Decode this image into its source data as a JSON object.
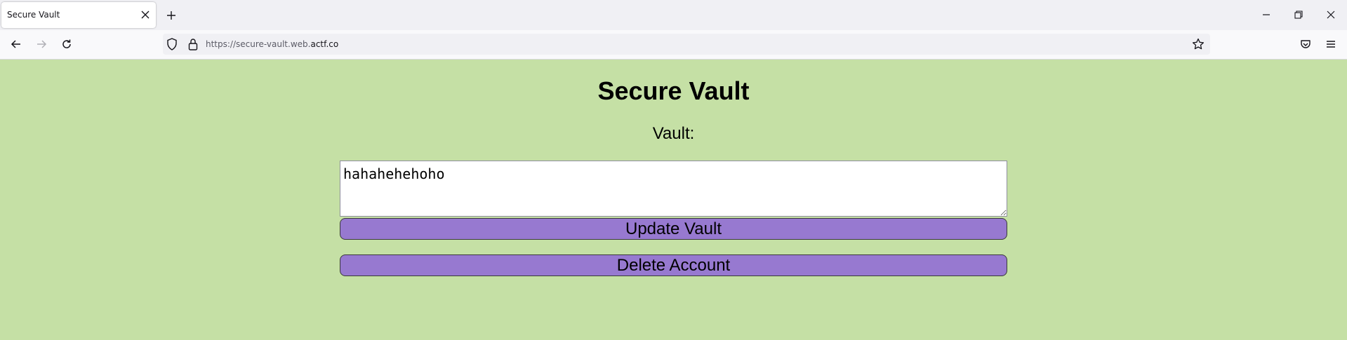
{
  "browser": {
    "tab_title": "Secure Vault",
    "url_prefix": "https://secure-vault.web.",
    "url_domain": "actf.co"
  },
  "page": {
    "title": "Secure Vault",
    "vault_label": "Vault:",
    "vault_value": "hahahehehoho",
    "update_button": "Update Vault",
    "delete_button": "Delete Account"
  },
  "colors": {
    "page_background": "#c5e0a5",
    "button_background": "#9779d0"
  },
  "icons": {
    "tab_close": "close-icon",
    "new_tab": "plus-icon",
    "back": "arrow-left-icon",
    "forward": "arrow-right-icon",
    "reload": "reload-icon",
    "tracking_protection": "shield-icon",
    "connection": "lock-icon",
    "bookmark": "star-icon",
    "pocket": "pocket-icon",
    "menu": "hamburger-menu-icon",
    "minimize": "minimize-icon",
    "restore": "restore-icon",
    "close_window": "close-window-icon"
  }
}
